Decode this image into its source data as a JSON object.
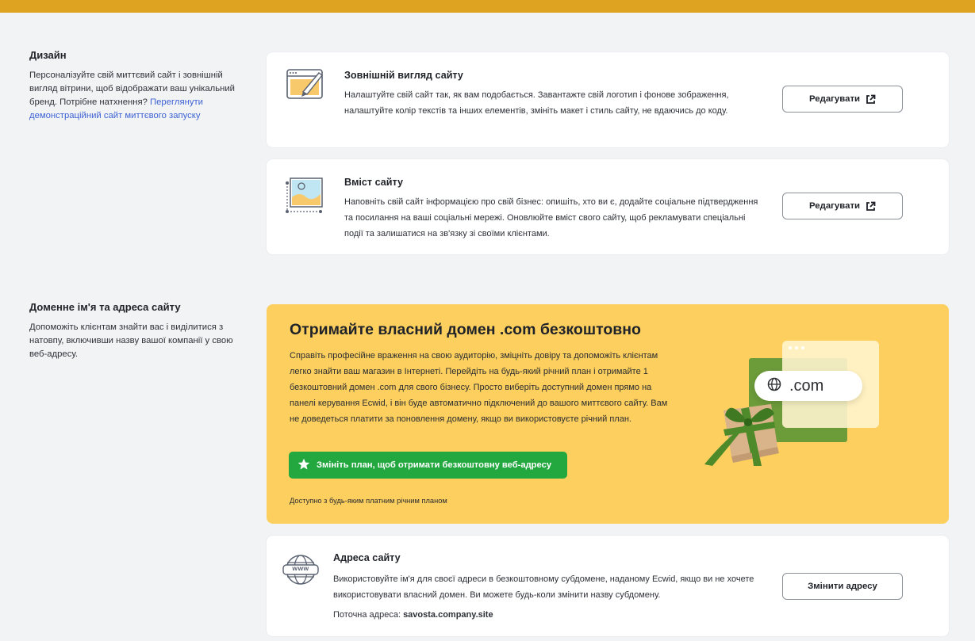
{
  "design": {
    "title": "Дизайн",
    "description": "Персоналізуйте свій миттєвий сайт і зовнішній вигляд вітрини, щоб відображати ваш унікальний бренд. Потрібне натхнення?",
    "demo_link": "Переглянути демонстраційний сайт миттєвого запуску",
    "cards": [
      {
        "title": "Зовнішній вигляд сайту",
        "text": "Налаштуйте свій сайт так, як вам подобається. Завантажте свій логотип і фонове зображення, налаштуйте колір текстів та інших елементів, змініть макет і стиль сайту, не вдаючись до коду.",
        "button": "Редагувати",
        "icon": "browser-brush-icon"
      },
      {
        "title": "Вміст сайту",
        "text": "Наповніть свій сайт інформацією про свій бізнес: опишіть, хто ви є, додайте соціальне підтвердження та посилання на ваші соціальні мережі. Оновлюйте вміст свого сайту, щоб рекламувати спеціальні події та залишатися на зв'язку зі своїми клієнтами.",
        "button": "Редагувати",
        "icon": "image-frame-icon"
      }
    ]
  },
  "domain": {
    "title": "Доменне ім'я та адреса сайту",
    "description": "Допоможіть клієнтам знайти вас і виділитися з натовпу, включивши назву вашої компанії у свою веб-адресу.",
    "promo": {
      "title": "Отримайте власний домен .com безкоштовно",
      "text": "Справіть професійне враження на свою аудиторію, зміцніть довіру та допоможіть клієнтам легко знайти ваш магазин в Інтернеті. Перейдіть на будь-який річний план і отримайте 1 безкоштовний домен .com для свого бізнесу. Просто виберіть доступний домен прямо на панелі керування Ecwid, і він буде автоматично підключений до вашого миттєвого сайту. Вам не доведеться платити за поновлення домену, якщо ви використовуєте річний план.",
      "button": "Змініть план, щоб отримати безкоштовну веб-адресу",
      "note": "Доступно з будь-яким платним річним планом",
      "illustration_text": ".com"
    },
    "address_card": {
      "title": "Адреса сайту",
      "text": "Використовуйте ім'я для своєї адреси в безкоштовному субдомене, наданому Ecwid, якщо ви не хочете використовувати власний домен. Ви можете будь-коли змінити назву субдомену.",
      "current_label": "Поточна адреса:",
      "current_value": "savosta.company.site",
      "button": "Змінити адресу",
      "icon_text": "www"
    }
  },
  "colors": {
    "accent_bar": "#dfa322",
    "promo_bg": "#fccf5e",
    "promo_button": "#23a73f",
    "link": "#3d63d4"
  }
}
